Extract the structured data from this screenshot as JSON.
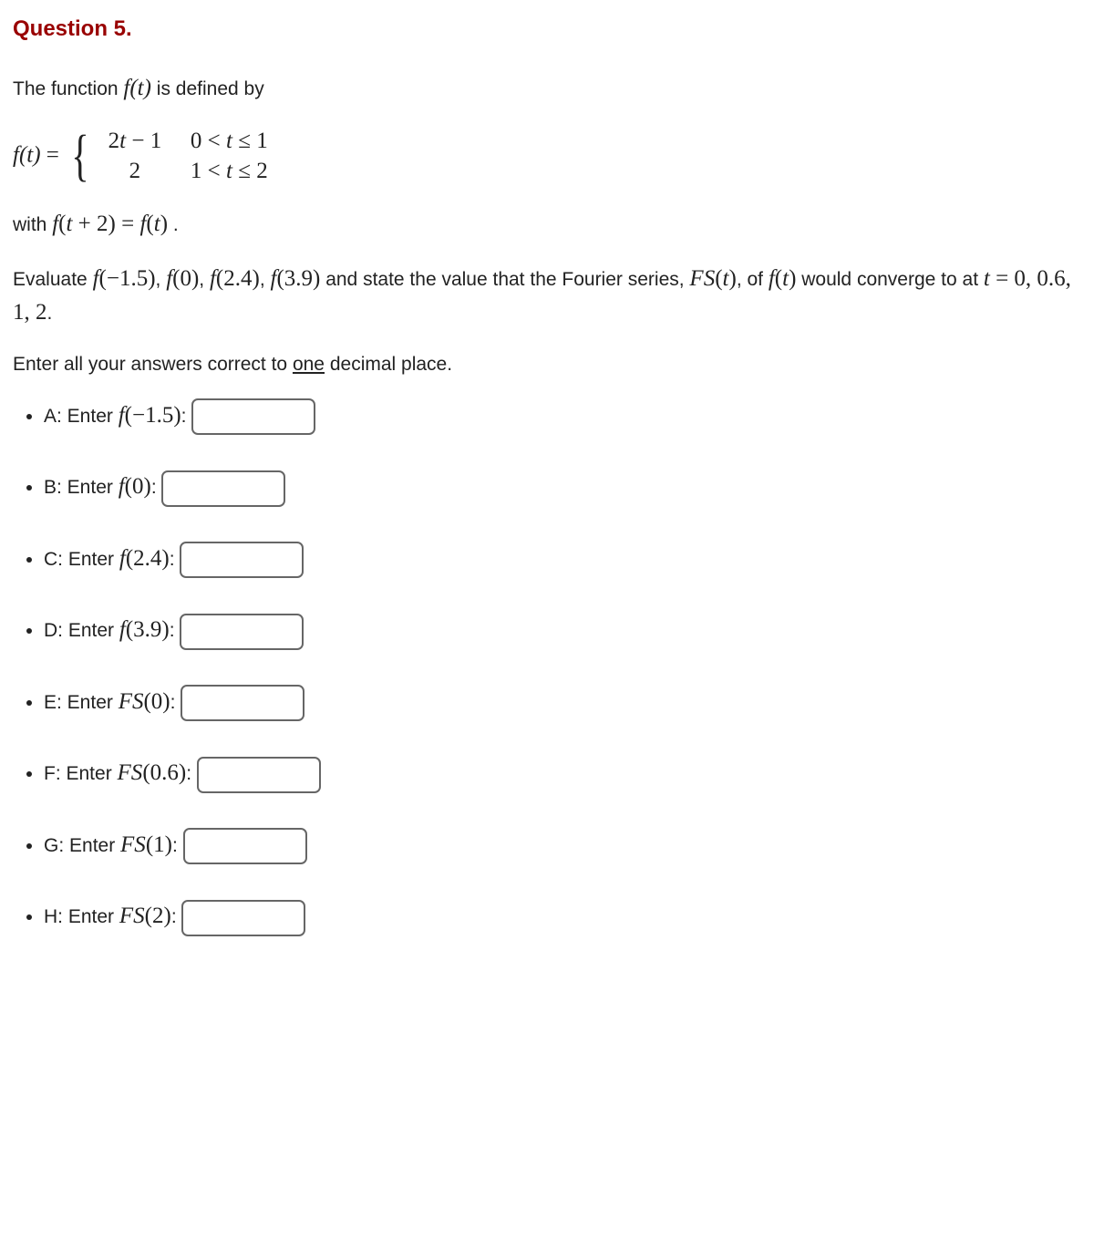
{
  "title": "Question 5.",
  "intro": "The function ",
  "intro_fn": "f(t)",
  "intro_tail": " is defined by",
  "piecewise": {
    "lhs_fn": "f(t)",
    "equals": " = ",
    "row1_expr": "2t − 1",
    "row1_cond": "0 < t ≤ 1",
    "row2_expr": "2",
    "row2_cond": "1 < t ≤ 2"
  },
  "periodic": {
    "prefix": "with ",
    "expr": "f(t + 2) = f(t)",
    "suffix": " ."
  },
  "evaluate": {
    "p1_a": "Evaluate ",
    "f1": "f(−1.5)",
    "sep": ", ",
    "f2": "f(0)",
    "f3": "f(2.4)",
    "f4": "f(3.9)",
    "p1_b": " and state the value that the Fourier series, ",
    "fs": "FS(t)",
    "p1_c": ", of ",
    "ft": "f(t)",
    "p1_d": " would converge to at ",
    "teq": "t = 0, 0.6, 1, 2",
    "p1_e": "."
  },
  "precision": {
    "a": "Enter all your answers correct to ",
    "one": "one",
    "b": " decimal place."
  },
  "items": {
    "a_pre": "A: Enter ",
    "a_fn": "f(−1.5)",
    "b_pre": "B: Enter ",
    "b_fn": "f(0)",
    "c_pre": "C: Enter ",
    "c_fn": "f(2.4)",
    "d_pre": "D: Enter ",
    "d_fn": "f(3.9)",
    "e_pre": "E: Enter ",
    "e_fn": "FS(0)",
    "f_pre": "F: Enter ",
    "f_fn": "FS(0.6)",
    "g_pre": "G: Enter ",
    "g_fn": "FS(1)",
    "h_pre": "H: Enter ",
    "h_fn": "FS(2)",
    "colon": ": "
  }
}
